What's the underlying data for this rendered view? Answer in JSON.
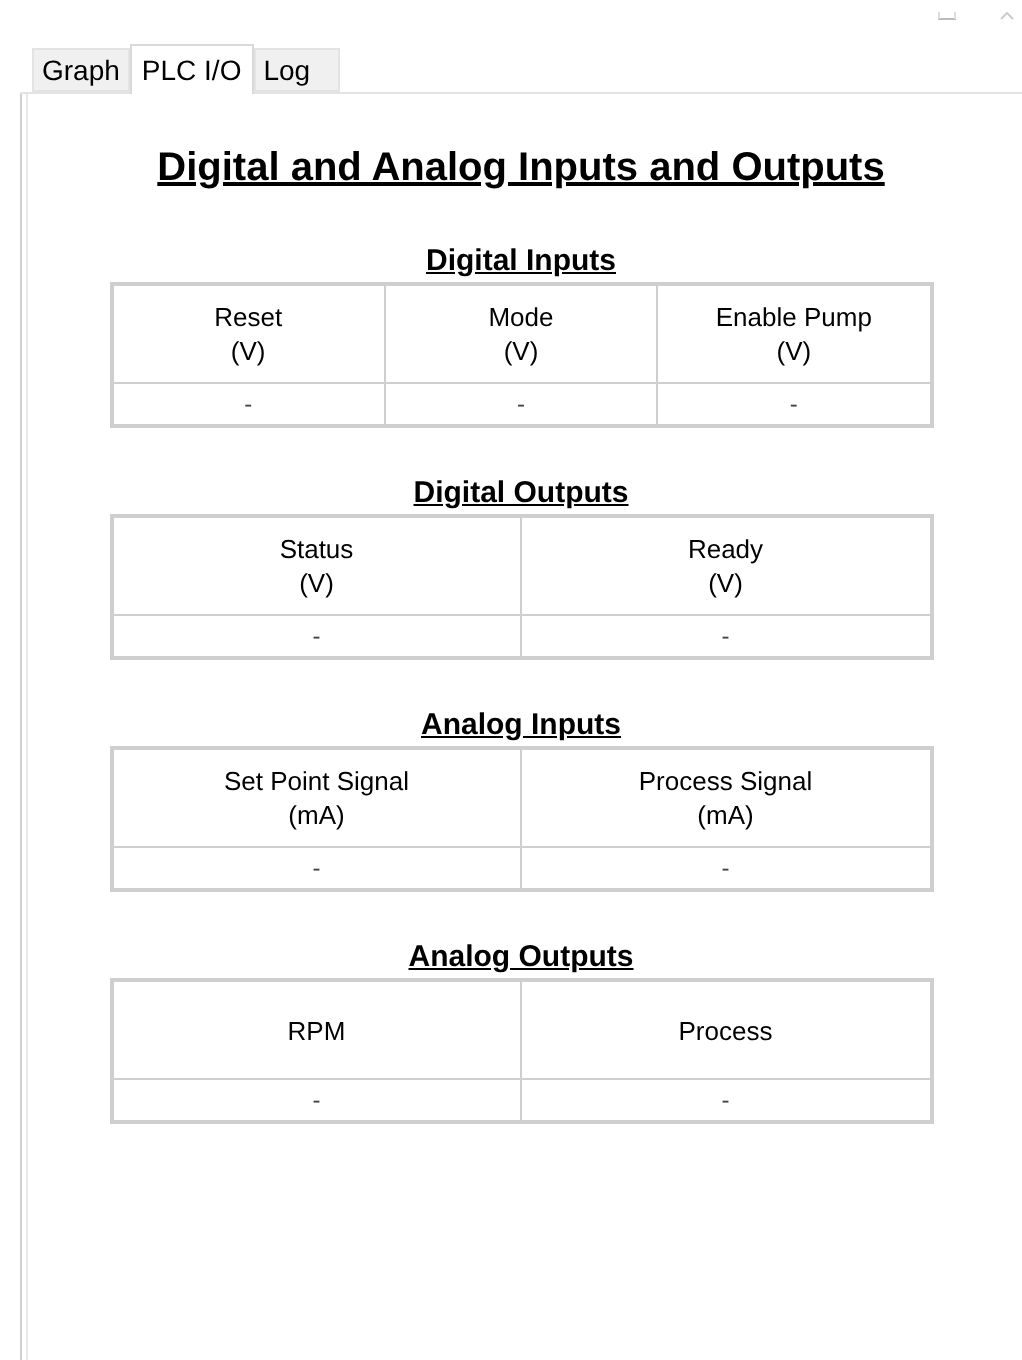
{
  "tabs": [
    {
      "label": "Graph",
      "selected": false
    },
    {
      "label": "PLC I/O",
      "selected": true
    },
    {
      "label": "Log",
      "selected": false
    }
  ],
  "title": "Digital and Analog Inputs and Outputs",
  "sections": [
    {
      "title": "Digital Inputs",
      "columns": [
        {
          "label": "Reset",
          "unit": "(V)"
        },
        {
          "label": "Mode",
          "unit": "(V)"
        },
        {
          "label": "Enable Pump",
          "unit": "(V)"
        }
      ],
      "values": [
        "-",
        "-",
        "-"
      ]
    },
    {
      "title": "Digital Outputs",
      "columns": [
        {
          "label": "Status",
          "unit": "(V)"
        },
        {
          "label": "Ready",
          "unit": "(V)"
        }
      ],
      "values": [
        "-",
        "-"
      ]
    },
    {
      "title": "Analog Inputs",
      "columns": [
        {
          "label": "Set Point Signal",
          "unit": "(mA)"
        },
        {
          "label": "Process Signal",
          "unit": "(mA)"
        }
      ],
      "values": [
        "-",
        "-"
      ]
    },
    {
      "title": "Analog Outputs",
      "columns": [
        {
          "label": "RPM"
        },
        {
          "label": "Process"
        }
      ],
      "values": [
        "-",
        "-"
      ]
    }
  ]
}
